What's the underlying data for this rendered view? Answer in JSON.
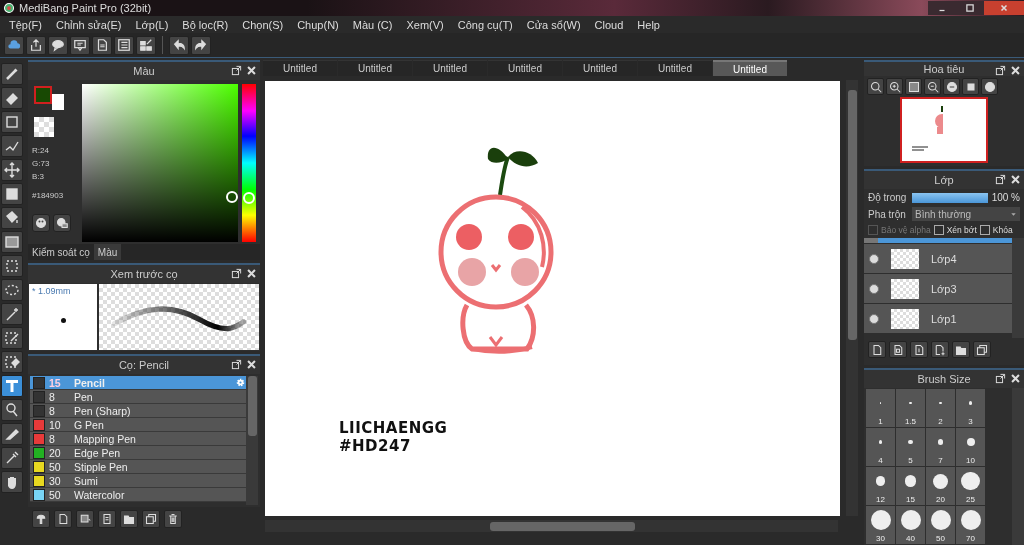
{
  "window": {
    "title": "MediBang Paint Pro (32bit)"
  },
  "menu": [
    "Tệp(F)",
    "Chỉnh sửa(E)",
    "Lớp(L)",
    "Bộ lọc(R)",
    "Chọn(S)",
    "Chụp(N)",
    "Màu (C)",
    "Xem(V)",
    "Công cụ(T)",
    "Cửa sổ(W)",
    "Cloud",
    "Help"
  ],
  "tools": [
    {
      "kind": "brush",
      "selected": false
    },
    {
      "kind": "eraser",
      "selected": false
    },
    {
      "kind": "shape",
      "selected": false
    },
    {
      "kind": "curve",
      "selected": false
    },
    {
      "kind": "move",
      "selected": false
    },
    {
      "kind": "fill",
      "selected": false
    },
    {
      "kind": "bucket",
      "selected": false
    },
    {
      "kind": "gradient",
      "selected": false
    },
    {
      "kind": "select",
      "selected": false
    },
    {
      "kind": "lasso",
      "selected": false
    },
    {
      "kind": "wand",
      "selected": false
    },
    {
      "kind": "select-pen",
      "selected": false
    },
    {
      "kind": "select-eraser",
      "selected": false
    },
    {
      "kind": "text",
      "selected": true
    },
    {
      "kind": "operation",
      "selected": false
    },
    {
      "kind": "knife",
      "selected": false
    },
    {
      "kind": "eyedropper",
      "selected": false
    },
    {
      "kind": "hand",
      "selected": false
    }
  ],
  "color_panel": {
    "title": "Màu",
    "red": "R:24",
    "green": "G:73",
    "blue": "B:3",
    "hex": "#184903",
    "hue_slider": {
      "level": 0.28
    },
    "tabs": [
      {
        "label": "Kiểm soát cọ",
        "selected": false
      },
      {
        "label": "Màu",
        "selected": true
      }
    ]
  },
  "brush_preview": {
    "title": "Xem trước cọ",
    "size": "* 1.09mm"
  },
  "brush_list": {
    "title": "Cọ: Pencil",
    "items": [
      {
        "size": "15",
        "name": "Pencil",
        "color": "#333333",
        "selected": true
      },
      {
        "size": "8",
        "name": "Pen",
        "color": "#333333",
        "selected": false
      },
      {
        "size": "8",
        "name": "Pen (Sharp)",
        "color": "#333333",
        "selected": false
      },
      {
        "size": "10",
        "name": "G Pen",
        "color": "#e83a3a",
        "selected": false
      },
      {
        "size": "8",
        "name": "Mapping Pen",
        "color": "#e83a3a",
        "selected": false
      },
      {
        "size": "20",
        "name": "Edge Pen",
        "color": "#22b022",
        "selected": false
      },
      {
        "size": "50",
        "name": "Stipple Pen",
        "color": "#e8d820",
        "selected": false
      },
      {
        "size": "30",
        "name": "Sumi",
        "color": "#e8d820",
        "selected": false
      },
      {
        "size": "50",
        "name": "Watercolor",
        "color": "#78d4f4",
        "selected": false
      }
    ]
  },
  "document_tabs": [
    {
      "label": "Untitled",
      "selected": false
    },
    {
      "label": "Untitled",
      "selected": false
    },
    {
      "label": "Untitled",
      "selected": false
    },
    {
      "label": "Untitled",
      "selected": false
    },
    {
      "label": "Untitled",
      "selected": false
    },
    {
      "label": "Untitled",
      "selected": false
    },
    {
      "label": "Untitled",
      "selected": true
    }
  ],
  "canvas": {
    "texts": [
      "LIICHAENGG",
      "#HD247"
    ]
  },
  "navigator": {
    "title": "Hoa tiêu"
  },
  "layers": {
    "title": "Lớp",
    "opacity_label": "Độ trong",
    "opacity": {
      "level": 1.0,
      "reading": "100 %"
    },
    "blend_label": "Pha trộn",
    "blend_value": "Bình thường",
    "options": [
      {
        "label": "Bảo vệ alpha",
        "checked": false,
        "disabled": true
      },
      {
        "label": "Xén bớt",
        "checked": false,
        "disabled": false
      },
      {
        "label": "Khóa",
        "checked": false,
        "disabled": false
      }
    ],
    "items": [
      {
        "name": "Lớp4",
        "visible": true
      },
      {
        "name": "Lớp3",
        "visible": true
      },
      {
        "name": "Lớp1",
        "visible": true
      }
    ]
  },
  "brush_size": {
    "title": "Brush Size",
    "sizes": [
      "1",
      "1.5",
      "2",
      "3",
      "4",
      "5",
      "7",
      "10",
      "12",
      "15",
      "20",
      "25",
      "30",
      "40",
      "50",
      "70"
    ]
  }
}
